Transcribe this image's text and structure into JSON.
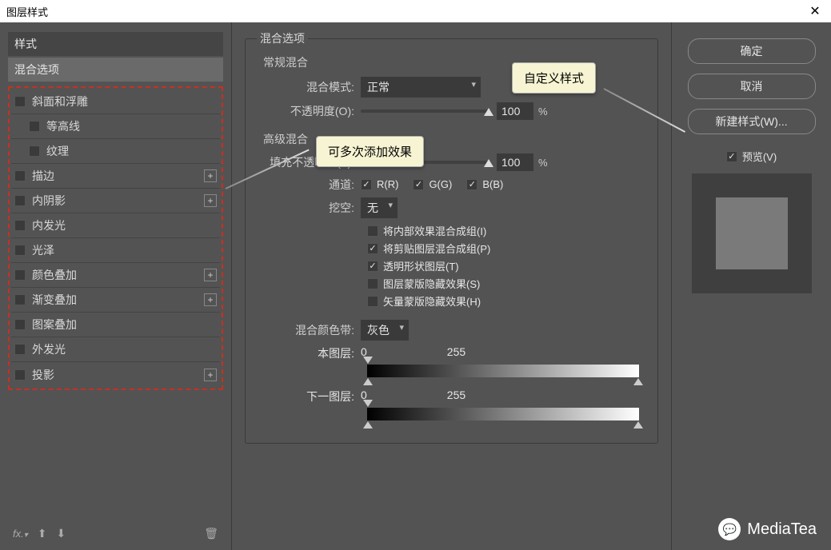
{
  "title": "图层样式",
  "left": {
    "header": "样式",
    "subheader": "混合选项",
    "effects": [
      {
        "label": "斜面和浮雕",
        "plus": false,
        "sub": false
      },
      {
        "label": "等高线",
        "plus": false,
        "sub": true
      },
      {
        "label": "纹理",
        "plus": false,
        "sub": true
      },
      {
        "label": "描边",
        "plus": true,
        "sub": false
      },
      {
        "label": "内阴影",
        "plus": true,
        "sub": false
      },
      {
        "label": "内发光",
        "plus": false,
        "sub": false
      },
      {
        "label": "光泽",
        "plus": false,
        "sub": false
      },
      {
        "label": "颜色叠加",
        "plus": true,
        "sub": false
      },
      {
        "label": "渐变叠加",
        "plus": true,
        "sub": false
      },
      {
        "label": "图案叠加",
        "plus": false,
        "sub": false
      },
      {
        "label": "外发光",
        "plus": false,
        "sub": false
      },
      {
        "label": "投影",
        "plus": true,
        "sub": false
      }
    ],
    "footer_fx": "fx"
  },
  "mid": {
    "section_title": "混合选项",
    "group1_title": "常规混合",
    "blend_mode_label": "混合模式:",
    "blend_mode_value": "正常",
    "opacity_label": "不透明度(O):",
    "opacity_value": "100",
    "pct": "%",
    "group2_title": "高级混合",
    "fill_opacity_label": "填充不透明度(F):",
    "fill_opacity_value": "100",
    "channels_label": "通道:",
    "ch_r": "R(R)",
    "ch_g": "G(G)",
    "ch_b": "B(B)",
    "knockout_label": "挖空:",
    "knockout_value": "无",
    "adv_checks": [
      {
        "label": "将内部效果混合成组(I)",
        "on": false
      },
      {
        "label": "将剪贴图层混合成组(P)",
        "on": true
      },
      {
        "label": "透明形状图层(T)",
        "on": true
      },
      {
        "label": "图层蒙版隐藏效果(S)",
        "on": false
      },
      {
        "label": "矢量蒙版隐藏效果(H)",
        "on": false
      }
    ],
    "blendif_label": "混合颜色带:",
    "blendif_value": "灰色",
    "this_layer_label": "本图层:",
    "this_layer_lo": "0",
    "this_layer_hi": "255",
    "under_layer_label": "下一图层:",
    "under_layer_lo": "0",
    "under_layer_hi": "255"
  },
  "right": {
    "ok": "确定",
    "cancel": "取消",
    "newstyle": "新建样式(W)...",
    "preview": "预览(V)"
  },
  "callouts": {
    "custom_style": "自定义样式",
    "multi_add": "可多次添加效果"
  },
  "watermark": "MediaTea"
}
